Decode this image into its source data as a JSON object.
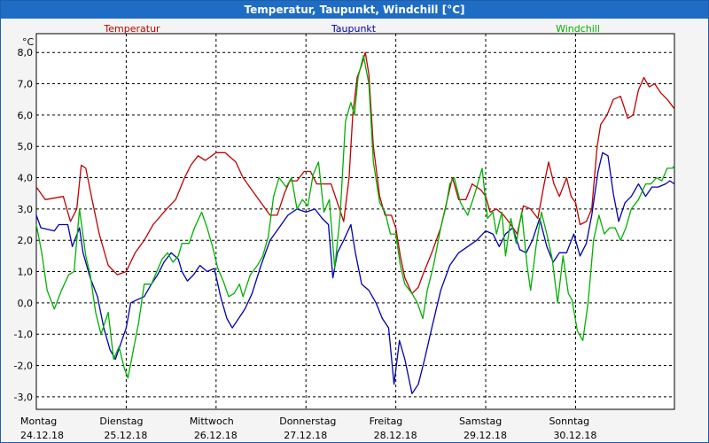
{
  "window": {
    "title": "Temperatur, Taupunkt, Windchill [°C]"
  },
  "chart_data": {
    "type": "line",
    "title": "Temperatur, Taupunkt, Windchill [°C]",
    "ylabel": "°C",
    "ylim": [
      -3.4,
      8.6
    ],
    "yticks": [
      8,
      7,
      6,
      5,
      4,
      3,
      2,
      1,
      0,
      -1,
      -2,
      -3
    ],
    "ytick_labels": [
      "8,0",
      "7,0",
      "6,0",
      "5,0",
      "4,0",
      "3,0",
      "2,0",
      "1,0",
      "0,0",
      "-1,0",
      "-2,0",
      "-3,0"
    ],
    "grid": true,
    "x_axis_days": [
      {
        "day": "Montag",
        "date": "24.12.18"
      },
      {
        "day": "Dienstag",
        "date": "25.12.18"
      },
      {
        "day": "Mittwoch",
        "date": "26.12.18"
      },
      {
        "day": "Donnerstag",
        "date": "27.12.18"
      },
      {
        "day": "Freitag",
        "date": "28.12.18"
      },
      {
        "day": "Samstag",
        "date": "29.12.18"
      },
      {
        "day": "Sonntag",
        "date": "30.12.18"
      }
    ],
    "xlim_days": [
      0,
      7.1
    ],
    "series": [
      {
        "name": "Temperatur",
        "color": "#c00000",
        "points": [
          [
            0,
            3.7
          ],
          [
            0.1,
            3.3
          ],
          [
            0.3,
            3.4
          ],
          [
            0.38,
            2.6
          ],
          [
            0.45,
            3.0
          ],
          [
            0.5,
            4.4
          ],
          [
            0.55,
            4.3
          ],
          [
            0.62,
            3.3
          ],
          [
            0.7,
            2.2
          ],
          [
            0.8,
            1.2
          ],
          [
            0.9,
            0.9
          ],
          [
            1.0,
            1.0
          ],
          [
            1.1,
            1.6
          ],
          [
            1.2,
            2.0
          ],
          [
            1.3,
            2.5
          ],
          [
            1.45,
            3.0
          ],
          [
            1.55,
            3.3
          ],
          [
            1.65,
            4.0
          ],
          [
            1.72,
            4.4
          ],
          [
            1.8,
            4.7
          ],
          [
            1.88,
            4.55
          ],
          [
            2.0,
            4.8
          ],
          [
            2.1,
            4.8
          ],
          [
            2.22,
            4.5
          ],
          [
            2.3,
            4.0
          ],
          [
            2.4,
            3.6
          ],
          [
            2.5,
            3.2
          ],
          [
            2.6,
            2.8
          ],
          [
            2.68,
            2.8
          ],
          [
            2.76,
            3.5
          ],
          [
            2.82,
            3.9
          ],
          [
            2.9,
            3.9
          ],
          [
            2.98,
            4.2
          ],
          [
            3.05,
            4.2
          ],
          [
            3.12,
            3.8
          ],
          [
            3.2,
            3.8
          ],
          [
            3.28,
            3.8
          ],
          [
            3.35,
            3.2
          ],
          [
            3.42,
            2.6
          ],
          [
            3.48,
            4.0
          ],
          [
            3.52,
            6.0
          ],
          [
            3.57,
            7.2
          ],
          [
            3.62,
            7.6
          ],
          [
            3.66,
            8.0
          ],
          [
            3.7,
            7.3
          ],
          [
            3.75,
            5.0
          ],
          [
            3.82,
            3.4
          ],
          [
            3.88,
            2.8
          ],
          [
            3.95,
            2.8
          ],
          [
            4.0,
            2.4
          ],
          [
            4.05,
            1.5
          ],
          [
            4.1,
            0.8
          ],
          [
            4.18,
            0.3
          ],
          [
            4.25,
            0.5
          ],
          [
            4.3,
            0.9
          ],
          [
            4.4,
            1.6
          ],
          [
            4.5,
            2.4
          ],
          [
            4.58,
            3.4
          ],
          [
            4.63,
            4.0
          ],
          [
            4.7,
            3.3
          ],
          [
            4.78,
            3.3
          ],
          [
            4.85,
            3.8
          ],
          [
            4.95,
            3.6
          ],
          [
            5.0,
            3.4
          ],
          [
            5.05,
            2.9
          ],
          [
            5.12,
            3.0
          ],
          [
            5.2,
            2.8
          ],
          [
            5.28,
            2.5
          ],
          [
            5.35,
            2.2
          ],
          [
            5.42,
            3.1
          ],
          [
            5.5,
            3.0
          ],
          [
            5.58,
            2.7
          ],
          [
            5.65,
            3.8
          ],
          [
            5.7,
            4.5
          ],
          [
            5.76,
            3.8
          ],
          [
            5.82,
            3.4
          ],
          [
            5.9,
            4.0
          ],
          [
            5.95,
            3.4
          ],
          [
            6.0,
            3.2
          ],
          [
            6.05,
            2.5
          ],
          [
            6.12,
            2.6
          ],
          [
            6.18,
            3.0
          ],
          [
            6.24,
            5.0
          ],
          [
            6.28,
            5.7
          ],
          [
            6.35,
            6.0
          ],
          [
            6.42,
            6.5
          ],
          [
            6.5,
            6.6
          ],
          [
            6.58,
            5.9
          ],
          [
            6.64,
            6.0
          ],
          [
            6.7,
            6.8
          ],
          [
            6.76,
            7.2
          ],
          [
            6.82,
            6.9
          ],
          [
            6.88,
            7.0
          ],
          [
            6.95,
            6.7
          ],
          [
            7.02,
            6.5
          ],
          [
            7.1,
            6.2
          ]
        ]
      },
      {
        "name": "Taupunkt",
        "color": "#0000b0",
        "points": [
          [
            0,
            2.8
          ],
          [
            0.05,
            2.4
          ],
          [
            0.2,
            2.3
          ],
          [
            0.25,
            2.5
          ],
          [
            0.35,
            2.5
          ],
          [
            0.4,
            1.8
          ],
          [
            0.48,
            2.4
          ],
          [
            0.52,
            1.6
          ],
          [
            0.6,
            0.8
          ],
          [
            0.68,
            0.2
          ],
          [
            0.75,
            -0.8
          ],
          [
            0.82,
            -1.5
          ],
          [
            0.88,
            -1.8
          ],
          [
            0.94,
            -1.3
          ],
          [
            1.0,
            -0.8
          ],
          [
            1.05,
            0.0
          ],
          [
            1.12,
            0.1
          ],
          [
            1.2,
            0.2
          ],
          [
            1.28,
            0.6
          ],
          [
            1.35,
            0.9
          ],
          [
            1.42,
            1.3
          ],
          [
            1.5,
            1.6
          ],
          [
            1.58,
            1.4
          ],
          [
            1.62,
            1.0
          ],
          [
            1.68,
            0.7
          ],
          [
            1.75,
            0.9
          ],
          [
            1.82,
            1.2
          ],
          [
            1.9,
            1.0
          ],
          [
            1.98,
            1.1
          ],
          [
            2.05,
            0.2
          ],
          [
            2.12,
            -0.5
          ],
          [
            2.18,
            -0.8
          ],
          [
            2.25,
            -0.5
          ],
          [
            2.32,
            -0.2
          ],
          [
            2.4,
            0.3
          ],
          [
            2.5,
            1.2
          ],
          [
            2.6,
            2.0
          ],
          [
            2.7,
            2.4
          ],
          [
            2.8,
            2.8
          ],
          [
            2.9,
            3.0
          ],
          [
            3.0,
            2.9
          ],
          [
            3.1,
            3.0
          ],
          [
            3.18,
            2.7
          ],
          [
            3.25,
            2.5
          ],
          [
            3.3,
            0.8
          ],
          [
            3.35,
            1.6
          ],
          [
            3.42,
            2.0
          ],
          [
            3.5,
            2.5
          ],
          [
            3.55,
            1.6
          ],
          [
            3.62,
            0.6
          ],
          [
            3.7,
            0.4
          ],
          [
            3.78,
            0.0
          ],
          [
            3.85,
            -0.5
          ],
          [
            3.92,
            -0.8
          ],
          [
            3.98,
            -2.6
          ],
          [
            4.04,
            -1.2
          ],
          [
            4.1,
            -1.8
          ],
          [
            4.18,
            -2.9
          ],
          [
            4.25,
            -2.6
          ],
          [
            4.32,
            -1.8
          ],
          [
            4.4,
            -0.8
          ],
          [
            4.5,
            0.4
          ],
          [
            4.6,
            1.2
          ],
          [
            4.7,
            1.6
          ],
          [
            4.8,
            1.8
          ],
          [
            4.9,
            2.0
          ],
          [
            5.0,
            2.3
          ],
          [
            5.08,
            2.2
          ],
          [
            5.15,
            1.8
          ],
          [
            5.22,
            2.2
          ],
          [
            5.3,
            2.4
          ],
          [
            5.38,
            1.7
          ],
          [
            5.45,
            1.6
          ],
          [
            5.52,
            2.0
          ],
          [
            5.6,
            2.7
          ],
          [
            5.68,
            1.8
          ],
          [
            5.75,
            1.3
          ],
          [
            5.82,
            1.6
          ],
          [
            5.9,
            1.6
          ],
          [
            5.98,
            2.2
          ],
          [
            6.05,
            1.5
          ],
          [
            6.12,
            1.9
          ],
          [
            6.18,
            2.8
          ],
          [
            6.25,
            4.2
          ],
          [
            6.3,
            4.8
          ],
          [
            6.36,
            4.7
          ],
          [
            6.42,
            3.5
          ],
          [
            6.48,
            2.6
          ],
          [
            6.55,
            3.2
          ],
          [
            6.62,
            3.4
          ],
          [
            6.7,
            3.8
          ],
          [
            6.78,
            3.4
          ],
          [
            6.85,
            3.7
          ],
          [
            6.92,
            3.7
          ],
          [
            7.0,
            3.8
          ],
          [
            7.05,
            3.9
          ],
          [
            7.1,
            3.8
          ]
        ]
      },
      {
        "name": "Windchill",
        "color": "#00b000",
        "points": [
          [
            0,
            2.5
          ],
          [
            0.06,
            1.6
          ],
          [
            0.12,
            0.4
          ],
          [
            0.2,
            -0.2
          ],
          [
            0.28,
            0.4
          ],
          [
            0.36,
            0.9
          ],
          [
            0.42,
            1.0
          ],
          [
            0.48,
            3.0
          ],
          [
            0.55,
            1.5
          ],
          [
            0.6,
            0.9
          ],
          [
            0.66,
            -0.3
          ],
          [
            0.72,
            -1.0
          ],
          [
            0.8,
            -0.3
          ],
          [
            0.86,
            -1.8
          ],
          [
            0.92,
            -1.4
          ],
          [
            0.98,
            -2.1
          ],
          [
            1.02,
            -2.4
          ],
          [
            1.08,
            -1.5
          ],
          [
            1.14,
            -0.6
          ],
          [
            1.2,
            0.6
          ],
          [
            1.28,
            0.6
          ],
          [
            1.34,
            1.0
          ],
          [
            1.4,
            1.4
          ],
          [
            1.46,
            1.6
          ],
          [
            1.52,
            1.3
          ],
          [
            1.58,
            1.5
          ],
          [
            1.62,
            1.9
          ],
          [
            1.7,
            1.9
          ],
          [
            1.76,
            2.4
          ],
          [
            1.84,
            2.9
          ],
          [
            1.9,
            2.4
          ],
          [
            1.96,
            1.8
          ],
          [
            2.02,
            1.1
          ],
          [
            2.08,
            0.7
          ],
          [
            2.14,
            0.2
          ],
          [
            2.2,
            0.3
          ],
          [
            2.26,
            0.6
          ],
          [
            2.3,
            0.2
          ],
          [
            2.38,
            0.9
          ],
          [
            2.46,
            1.2
          ],
          [
            2.52,
            1.5
          ],
          [
            2.58,
            2.1
          ],
          [
            2.64,
            3.4
          ],
          [
            2.7,
            4.0
          ],
          [
            2.78,
            3.7
          ],
          [
            2.84,
            4.0
          ],
          [
            2.9,
            3.0
          ],
          [
            2.96,
            3.3
          ],
          [
            3.02,
            3.1
          ],
          [
            3.08,
            4.1
          ],
          [
            3.14,
            4.5
          ],
          [
            3.2,
            2.9
          ],
          [
            3.26,
            3.3
          ],
          [
            3.32,
            1.1
          ],
          [
            3.38,
            2.8
          ],
          [
            3.44,
            5.8
          ],
          [
            3.5,
            6.4
          ],
          [
            3.54,
            6.0
          ],
          [
            3.58,
            7.2
          ],
          [
            3.64,
            7.9
          ],
          [
            3.7,
            7.0
          ],
          [
            3.75,
            4.5
          ],
          [
            3.82,
            3.2
          ],
          [
            3.88,
            2.9
          ],
          [
            3.94,
            2.2
          ],
          [
            4.0,
            2.2
          ],
          [
            4.05,
            1.2
          ],
          [
            4.1,
            0.6
          ],
          [
            4.18,
            0.3
          ],
          [
            4.24,
            0.0
          ],
          [
            4.3,
            -0.5
          ],
          [
            4.35,
            0.4
          ],
          [
            4.42,
            1.2
          ],
          [
            4.5,
            2.4
          ],
          [
            4.56,
            3.1
          ],
          [
            4.6,
            3.8
          ],
          [
            4.65,
            4.0
          ],
          [
            4.72,
            3.2
          ],
          [
            4.8,
            2.8
          ],
          [
            4.88,
            3.5
          ],
          [
            4.96,
            4.3
          ],
          [
            5.02,
            2.7
          ],
          [
            5.08,
            2.9
          ],
          [
            5.12,
            2.2
          ],
          [
            5.18,
            2.9
          ],
          [
            5.22,
            1.5
          ],
          [
            5.28,
            2.7
          ],
          [
            5.34,
            1.9
          ],
          [
            5.4,
            2.9
          ],
          [
            5.46,
            1.2
          ],
          [
            5.5,
            0.4
          ],
          [
            5.56,
            1.8
          ],
          [
            5.62,
            2.9
          ],
          [
            5.68,
            2.2
          ],
          [
            5.74,
            1.4
          ],
          [
            5.8,
            0.0
          ],
          [
            5.86,
            1.5
          ],
          [
            5.92,
            0.3
          ],
          [
            5.96,
            0.1
          ],
          [
            6.02,
            -0.9
          ],
          [
            6.08,
            -1.2
          ],
          [
            6.14,
            0.0
          ],
          [
            6.2,
            2.0
          ],
          [
            6.26,
            2.8
          ],
          [
            6.32,
            2.2
          ],
          [
            6.38,
            2.4
          ],
          [
            6.44,
            2.4
          ],
          [
            6.5,
            2.0
          ],
          [
            6.56,
            2.4
          ],
          [
            6.62,
            3.0
          ],
          [
            6.7,
            3.3
          ],
          [
            6.78,
            3.8
          ],
          [
            6.84,
            3.8
          ],
          [
            6.9,
            4.0
          ],
          [
            6.96,
            3.9
          ],
          [
            7.02,
            4.3
          ],
          [
            7.08,
            4.3
          ],
          [
            7.1,
            4.4
          ]
        ]
      }
    ]
  }
}
